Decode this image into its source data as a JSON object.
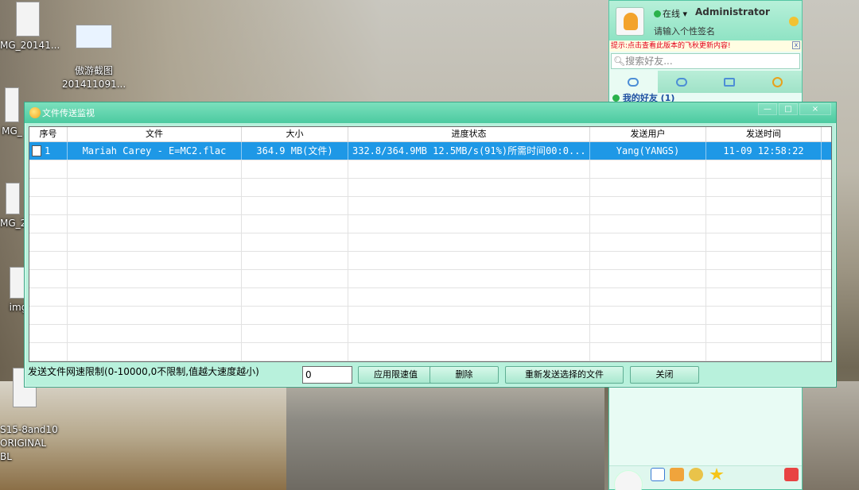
{
  "desktop": {
    "icons": [
      {
        "label": "MG_20141..."
      },
      {
        "label": "傲游截图\n201411091..."
      },
      {
        "label": "MG_"
      },
      {
        "label": "MG_2"
      },
      {
        "label": "img"
      },
      {
        "label": "S15-8and10\nORIGINAL BL"
      }
    ]
  },
  "qq": {
    "status": "在线",
    "username": "Administrator",
    "signature": "请输入个性签名",
    "notice": "提示:点击查看此版本的飞秋更新内容!",
    "notice_close": "x",
    "search_placeholder": "搜索好友...",
    "group_label": "我的好友 (1)",
    "tab_icons": [
      "chat-bubble-icon",
      "group-chat-icon",
      "contacts-icon",
      "globe-icon"
    ]
  },
  "window": {
    "title": "文件传送监视",
    "controls": {
      "minimize": "—",
      "maximize": "□",
      "close": "×"
    },
    "columns": [
      "序号",
      "文件",
      "大小",
      "进度状态",
      "发送用户",
      "发送时间"
    ],
    "rows": [
      {
        "index": "1",
        "file": "Mariah Carey - E=MC2.flac",
        "size": "364.9 MB(文件)",
        "progress": "332.8/364.9MB 12.5MB/s(91%)所需时间00:0...",
        "user": "Yang(YANGS)",
        "time": "11-09 12:58:22"
      }
    ],
    "empty_rows": 11,
    "limit_label": "发送文件网速限制(0-10000,0不限制,值越大速度越小)",
    "limit_value": "0",
    "buttons": {
      "apply": "应用限速值",
      "delete": "删除",
      "resend": "重新发送选择的文件",
      "close": "关闭"
    }
  },
  "colors": {
    "accent": "#4ccaa0",
    "selection": "#1e98e6",
    "notice_text": "#e2001a"
  }
}
